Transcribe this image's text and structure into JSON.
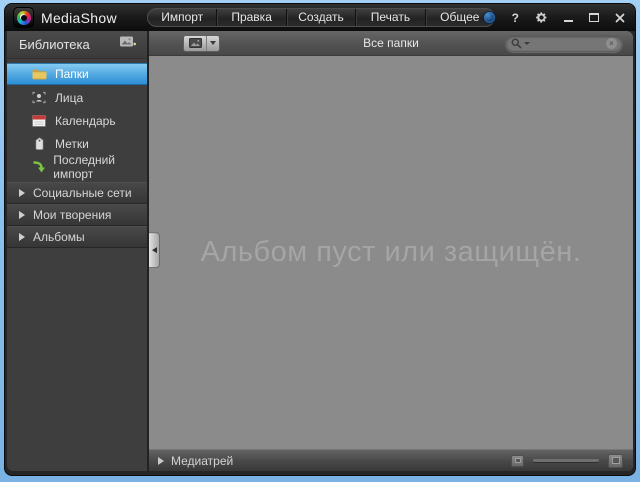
{
  "window": {
    "title": "MediaShow"
  },
  "titlebar": {
    "menu": [
      {
        "label": "Импорт"
      },
      {
        "label": "Правка"
      },
      {
        "label": "Создать"
      },
      {
        "label": "Печать"
      },
      {
        "label": "Общее"
      }
    ],
    "help_glyph": "?"
  },
  "sidebar": {
    "header": "Библиотека",
    "items": [
      {
        "label": "Папки",
        "icon": "folder-icon",
        "selected": true
      },
      {
        "label": "Лица",
        "icon": "faces-icon",
        "selected": false
      },
      {
        "label": "Календарь",
        "icon": "calendar-icon",
        "selected": false
      },
      {
        "label": "Метки",
        "icon": "tags-icon",
        "selected": false
      },
      {
        "label": "Последний импорт",
        "icon": "import-arrow-icon",
        "selected": false
      }
    ],
    "sections": [
      {
        "label": "Социальные сети"
      },
      {
        "label": "Мои творения"
      },
      {
        "label": "Альбомы"
      }
    ]
  },
  "toolbar": {
    "view_title": "Все папки",
    "search": {
      "value": ""
    }
  },
  "main": {
    "empty_message": "Альбом пуст или защищён."
  },
  "tray": {
    "label": "Медиатрей"
  },
  "colors": {
    "frame": "#8cc2ee",
    "selection_top": "#85cbf3",
    "selection_bottom": "#2f8ed6",
    "canvas": "#8b8b8b",
    "import_arrow_green": "#7dc243",
    "folder_yellow": "#e3c05c",
    "calendar_red": "#cc3333"
  }
}
